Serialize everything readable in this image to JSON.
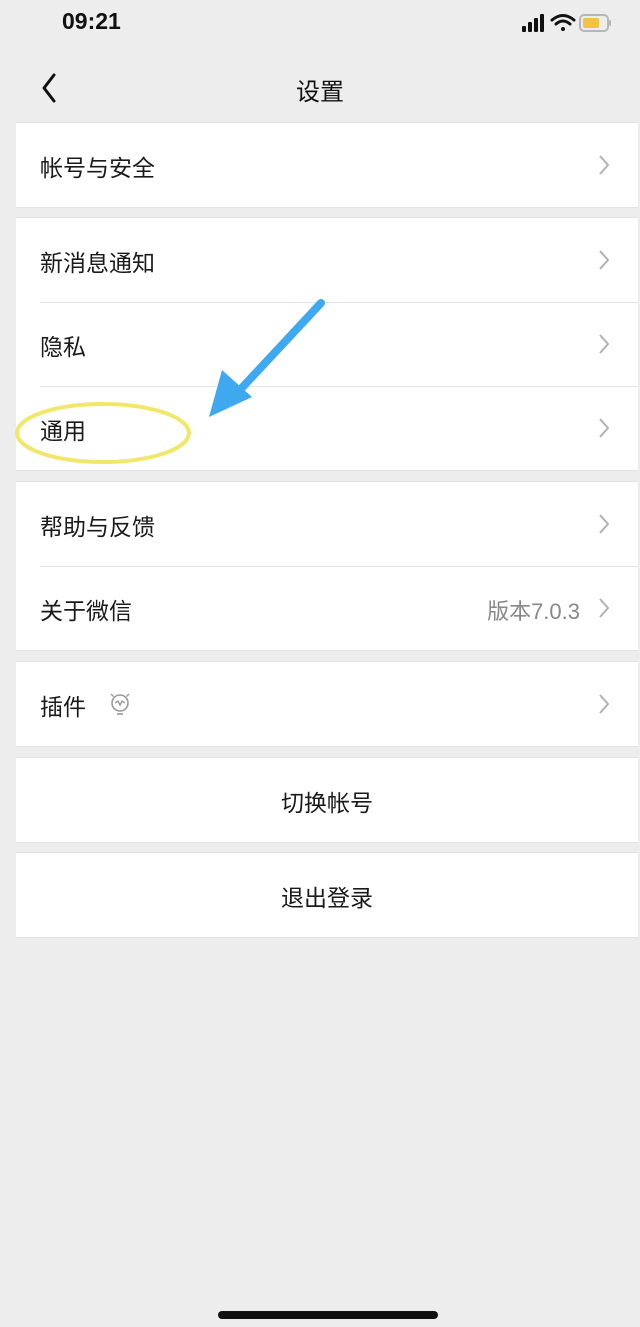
{
  "status_bar": {
    "time": "09:21",
    "icons": [
      "signal-icon",
      "wifi-icon",
      "battery-icon"
    ],
    "battery_color": "#f5c33b"
  },
  "nav": {
    "title": "设置",
    "back_icon": "chevron-left-icon"
  },
  "groups": [
    {
      "items": [
        {
          "label": "帐号与安全"
        }
      ]
    },
    {
      "items": [
        {
          "label": "新消息通知"
        },
        {
          "label": "隐私"
        },
        {
          "label": "通用"
        }
      ]
    },
    {
      "items": [
        {
          "label": "帮助与反馈"
        },
        {
          "label": "关于微信",
          "value": "版本7.0.3"
        }
      ]
    },
    {
      "items": [
        {
          "label": "插件",
          "icon": "plugin-bulb-icon"
        }
      ]
    }
  ],
  "actions": {
    "switch_account": "切换帐号",
    "logout": "退出登录"
  },
  "annotations": {
    "arrow_color": "#3fa9f0",
    "highlight_color": "#f1e76a"
  },
  "colors": {
    "background": "#ededed",
    "cell": "#ffffff",
    "secondary_text": "#888888",
    "chevron": "#b2b2b2"
  }
}
